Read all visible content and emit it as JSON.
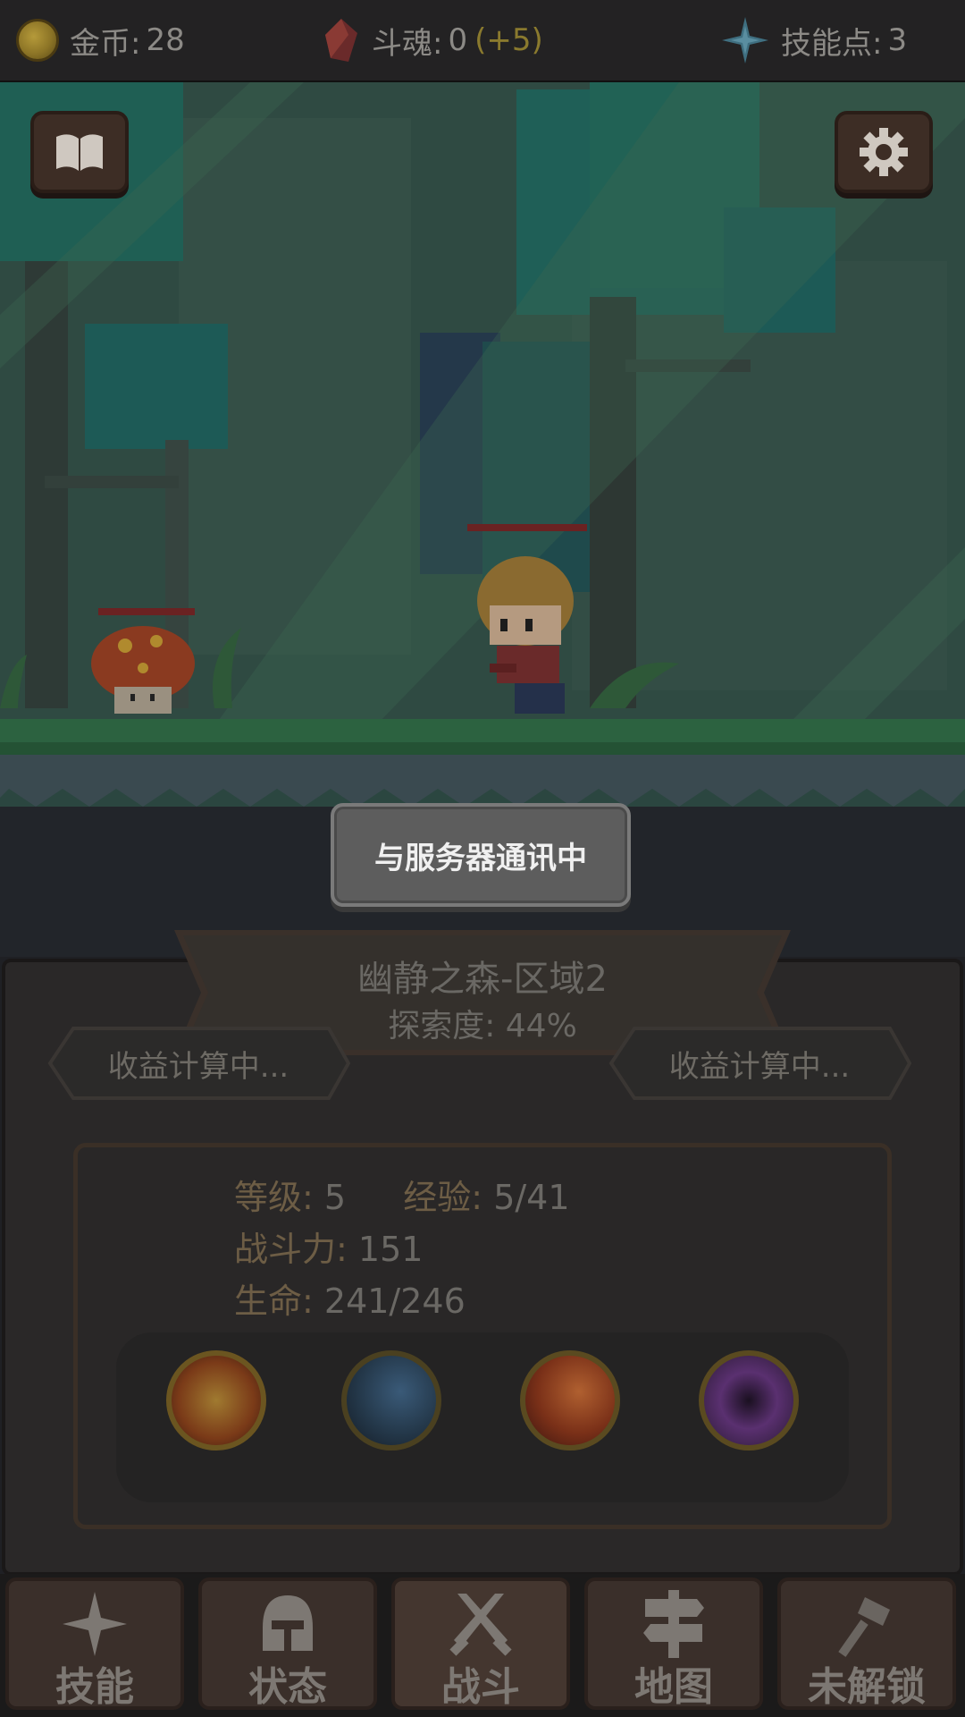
{
  "topbar": {
    "gold_label": "金币:",
    "gold_value": "28",
    "soul_label": "斗魂:",
    "soul_value": "0",
    "soul_bonus": "(+5)",
    "skill_points_label": "技能点:",
    "skill_points_value": "3"
  },
  "scene": {
    "left_button_icon": "book-icon",
    "right_button_icon": "gear-icon"
  },
  "popup": {
    "message": "与服务器通讯中"
  },
  "zone": {
    "title": "幽静之森-区域2",
    "explore": "探索度: 44%",
    "left_reward": "收益计算中...",
    "right_reward": "收益计算中..."
  },
  "stats": {
    "level_label": "等级:",
    "level_value": "5",
    "exp_label": "经验:",
    "exp_value": "5/41",
    "power_label": "战斗力:",
    "power_value": "151",
    "hp_label": "生命:",
    "hp_value": "241/246"
  },
  "skills": [
    {
      "icon": "fire-burst-icon",
      "color": "#8a4a20"
    },
    {
      "icon": "wind-slash-icon",
      "color": "#24384a"
    },
    {
      "icon": "flame-slash-icon",
      "color": "#8a3a20"
    },
    {
      "icon": "vortex-icon",
      "color": "#4a2a5a"
    }
  ],
  "nav": [
    {
      "label": "技能",
      "icon": "sparkle-icon"
    },
    {
      "label": "状态",
      "icon": "helmet-icon"
    },
    {
      "label": "战斗",
      "icon": "crossed-swords-icon"
    },
    {
      "label": "地图",
      "icon": "signpost-icon"
    },
    {
      "label": "未解锁",
      "icon": "hammer-icon"
    }
  ],
  "colors": {
    "accent_gold": "#8a7a2e",
    "text_muted": "#6a6864"
  }
}
